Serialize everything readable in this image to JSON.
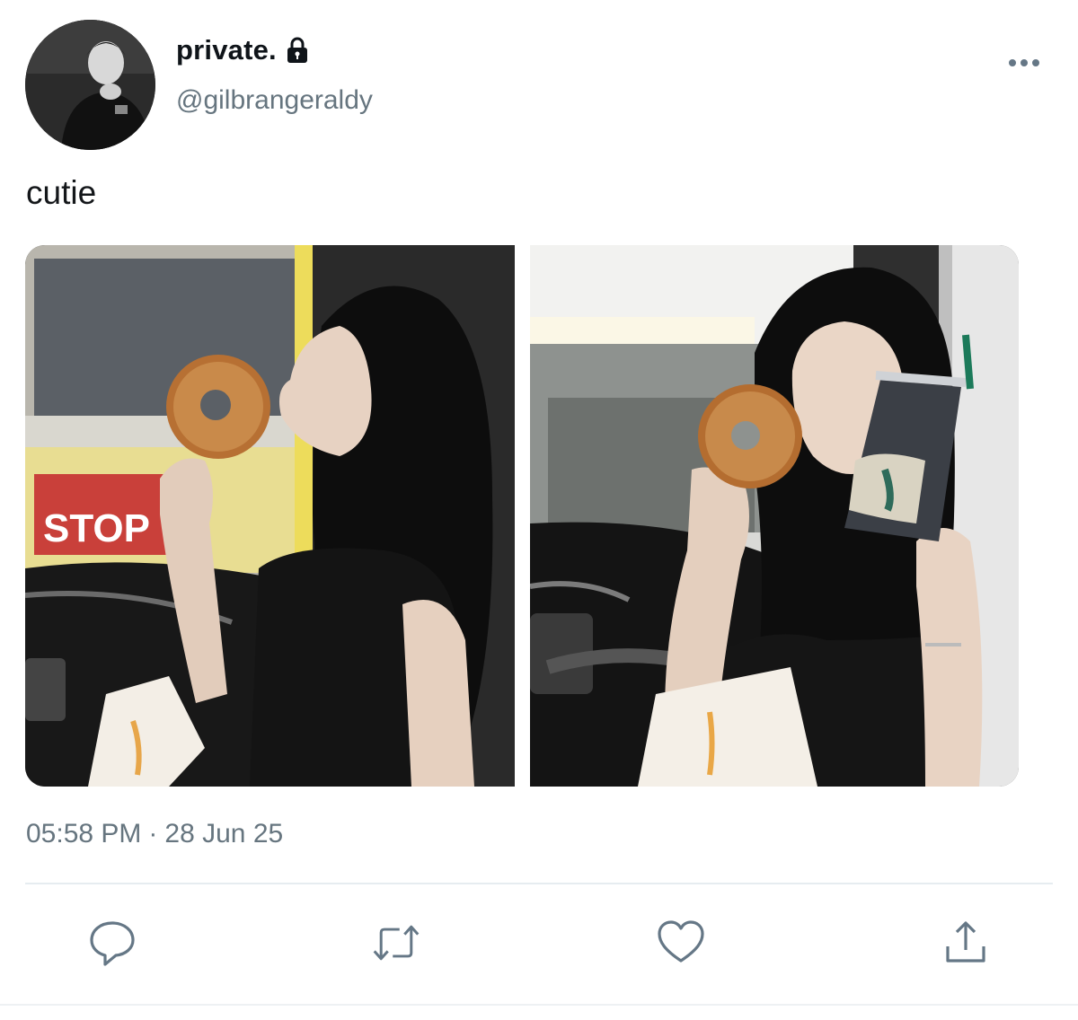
{
  "user": {
    "display_name": "private.",
    "handle": "@gilbrangeraldy",
    "avatar_icon": "profile-photo",
    "verified_icon": "lock-icon"
  },
  "tweet": {
    "text": "cutie",
    "time": "05:58 PM",
    "separator": "·",
    "date": "28 Jun 25"
  },
  "media": [
    {
      "name": "photo-1",
      "description_icon": "photo"
    },
    {
      "name": "photo-2",
      "description_icon": "photo"
    }
  ],
  "actions": {
    "reply_icon": "reply-icon",
    "retweet_icon": "retweet-icon",
    "like_icon": "heart-icon",
    "share_icon": "share-icon"
  },
  "colors": {
    "text_primary": "#0f1419",
    "text_secondary": "#66757f",
    "icon_gray": "#657786",
    "divider": "#e6ecf0"
  }
}
